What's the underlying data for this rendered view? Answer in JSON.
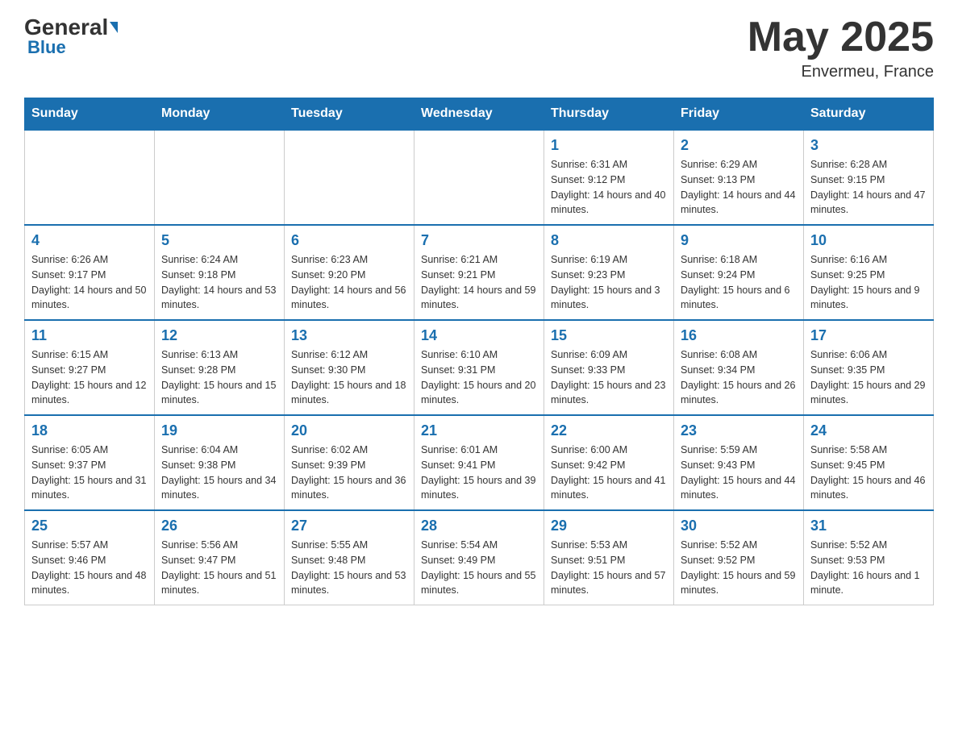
{
  "header": {
    "logo": {
      "general": "General",
      "blue": "Blue"
    },
    "title": "May 2025",
    "location": "Envermeu, France"
  },
  "days_of_week": [
    "Sunday",
    "Monday",
    "Tuesday",
    "Wednesday",
    "Thursday",
    "Friday",
    "Saturday"
  ],
  "weeks": [
    [
      {
        "day": "",
        "info": ""
      },
      {
        "day": "",
        "info": ""
      },
      {
        "day": "",
        "info": ""
      },
      {
        "day": "",
        "info": ""
      },
      {
        "day": "1",
        "info": "Sunrise: 6:31 AM\nSunset: 9:12 PM\nDaylight: 14 hours and 40 minutes."
      },
      {
        "day": "2",
        "info": "Sunrise: 6:29 AM\nSunset: 9:13 PM\nDaylight: 14 hours and 44 minutes."
      },
      {
        "day": "3",
        "info": "Sunrise: 6:28 AM\nSunset: 9:15 PM\nDaylight: 14 hours and 47 minutes."
      }
    ],
    [
      {
        "day": "4",
        "info": "Sunrise: 6:26 AM\nSunset: 9:17 PM\nDaylight: 14 hours and 50 minutes."
      },
      {
        "day": "5",
        "info": "Sunrise: 6:24 AM\nSunset: 9:18 PM\nDaylight: 14 hours and 53 minutes."
      },
      {
        "day": "6",
        "info": "Sunrise: 6:23 AM\nSunset: 9:20 PM\nDaylight: 14 hours and 56 minutes."
      },
      {
        "day": "7",
        "info": "Sunrise: 6:21 AM\nSunset: 9:21 PM\nDaylight: 14 hours and 59 minutes."
      },
      {
        "day": "8",
        "info": "Sunrise: 6:19 AM\nSunset: 9:23 PM\nDaylight: 15 hours and 3 minutes."
      },
      {
        "day": "9",
        "info": "Sunrise: 6:18 AM\nSunset: 9:24 PM\nDaylight: 15 hours and 6 minutes."
      },
      {
        "day": "10",
        "info": "Sunrise: 6:16 AM\nSunset: 9:25 PM\nDaylight: 15 hours and 9 minutes."
      }
    ],
    [
      {
        "day": "11",
        "info": "Sunrise: 6:15 AM\nSunset: 9:27 PM\nDaylight: 15 hours and 12 minutes."
      },
      {
        "day": "12",
        "info": "Sunrise: 6:13 AM\nSunset: 9:28 PM\nDaylight: 15 hours and 15 minutes."
      },
      {
        "day": "13",
        "info": "Sunrise: 6:12 AM\nSunset: 9:30 PM\nDaylight: 15 hours and 18 minutes."
      },
      {
        "day": "14",
        "info": "Sunrise: 6:10 AM\nSunset: 9:31 PM\nDaylight: 15 hours and 20 minutes."
      },
      {
        "day": "15",
        "info": "Sunrise: 6:09 AM\nSunset: 9:33 PM\nDaylight: 15 hours and 23 minutes."
      },
      {
        "day": "16",
        "info": "Sunrise: 6:08 AM\nSunset: 9:34 PM\nDaylight: 15 hours and 26 minutes."
      },
      {
        "day": "17",
        "info": "Sunrise: 6:06 AM\nSunset: 9:35 PM\nDaylight: 15 hours and 29 minutes."
      }
    ],
    [
      {
        "day": "18",
        "info": "Sunrise: 6:05 AM\nSunset: 9:37 PM\nDaylight: 15 hours and 31 minutes."
      },
      {
        "day": "19",
        "info": "Sunrise: 6:04 AM\nSunset: 9:38 PM\nDaylight: 15 hours and 34 minutes."
      },
      {
        "day": "20",
        "info": "Sunrise: 6:02 AM\nSunset: 9:39 PM\nDaylight: 15 hours and 36 minutes."
      },
      {
        "day": "21",
        "info": "Sunrise: 6:01 AM\nSunset: 9:41 PM\nDaylight: 15 hours and 39 minutes."
      },
      {
        "day": "22",
        "info": "Sunrise: 6:00 AM\nSunset: 9:42 PM\nDaylight: 15 hours and 41 minutes."
      },
      {
        "day": "23",
        "info": "Sunrise: 5:59 AM\nSunset: 9:43 PM\nDaylight: 15 hours and 44 minutes."
      },
      {
        "day": "24",
        "info": "Sunrise: 5:58 AM\nSunset: 9:45 PM\nDaylight: 15 hours and 46 minutes."
      }
    ],
    [
      {
        "day": "25",
        "info": "Sunrise: 5:57 AM\nSunset: 9:46 PM\nDaylight: 15 hours and 48 minutes."
      },
      {
        "day": "26",
        "info": "Sunrise: 5:56 AM\nSunset: 9:47 PM\nDaylight: 15 hours and 51 minutes."
      },
      {
        "day": "27",
        "info": "Sunrise: 5:55 AM\nSunset: 9:48 PM\nDaylight: 15 hours and 53 minutes."
      },
      {
        "day": "28",
        "info": "Sunrise: 5:54 AM\nSunset: 9:49 PM\nDaylight: 15 hours and 55 minutes."
      },
      {
        "day": "29",
        "info": "Sunrise: 5:53 AM\nSunset: 9:51 PM\nDaylight: 15 hours and 57 minutes."
      },
      {
        "day": "30",
        "info": "Sunrise: 5:52 AM\nSunset: 9:52 PM\nDaylight: 15 hours and 59 minutes."
      },
      {
        "day": "31",
        "info": "Sunrise: 5:52 AM\nSunset: 9:53 PM\nDaylight: 16 hours and 1 minute."
      }
    ]
  ]
}
